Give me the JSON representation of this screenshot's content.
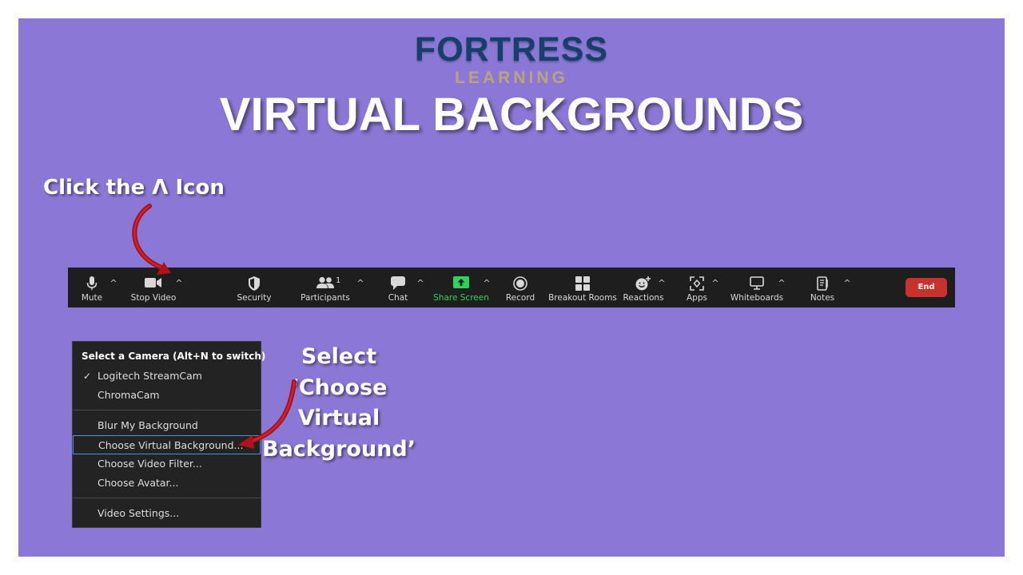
{
  "logo": {
    "brand": "FORTRESS",
    "sub": "LEARNING"
  },
  "title": "VIRTUAL BACKGROUNDS",
  "callouts": {
    "click_before": "Click the ",
    "click_glyph": "Λ",
    "click_after": " Icon",
    "select_lines": [
      "Select",
      "‘Choose",
      "Virtual",
      "Background’"
    ]
  },
  "toolbar": {
    "mute": "Mute",
    "stop_video": "Stop Video",
    "security": "Security",
    "participants": "Participants",
    "participants_count": "1",
    "chat": "Chat",
    "share_screen": "Share Screen",
    "record": "Record",
    "breakout_rooms": "Breakout Rooms",
    "reactions": "Reactions",
    "apps": "Apps",
    "whiteboards": "Whiteboards",
    "notes": "Notes",
    "end": "End",
    "caret": "^"
  },
  "camera_menu": {
    "header": "Select a Camera (Alt+N to switch)",
    "cameras": [
      "Logitech StreamCam",
      "ChromaCam"
    ],
    "checkmark": "✓",
    "options": [
      "Blur My Background",
      "Choose Virtual Background...",
      "Choose Video Filter...",
      "Choose Avatar..."
    ],
    "settings": "Video Settings..."
  },
  "colors": {
    "slide_bg": "#8b78d6",
    "logo_blue": "#16406a",
    "logo_gold": "#b8a67a",
    "toolbar_bg": "#1e1e1e",
    "share_green": "#2fd35c",
    "end_red": "#c8322c",
    "arrow_red": "#b0121b",
    "selected_border": "#4a8fe0"
  },
  "icons": [
    "microphone-icon",
    "video-camera-icon",
    "shield-icon",
    "participants-icon",
    "chat-bubble-icon",
    "share-screen-icon",
    "record-icon",
    "breakout-rooms-icon",
    "reactions-icon",
    "apps-icon",
    "whiteboard-icon",
    "notes-icon",
    "caret-up-icon",
    "checkmark-icon",
    "curved-arrow-icon"
  ]
}
